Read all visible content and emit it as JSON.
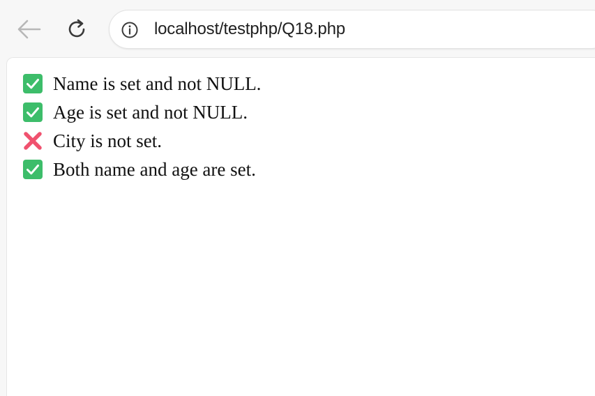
{
  "browser": {
    "url": "localhost/testphp/Q18.php",
    "back_icon": "arrow-left-icon",
    "reload_icon": "reload-icon",
    "info_icon": "info-icon"
  },
  "content": {
    "lines": [
      {
        "status": "check",
        "icon": "check-mark-button-icon",
        "text": "Name is set and not NULL."
      },
      {
        "status": "check",
        "icon": "check-mark-button-icon",
        "text": "Age is set and not NULL."
      },
      {
        "status": "cross",
        "icon": "cross-mark-icon",
        "text": "City is not set."
      },
      {
        "status": "check",
        "icon": "check-mark-button-icon",
        "text": "Both name and age are set."
      }
    ]
  },
  "colors": {
    "check_green": "#3dbd6a",
    "cross_pink": "#f0526f"
  }
}
